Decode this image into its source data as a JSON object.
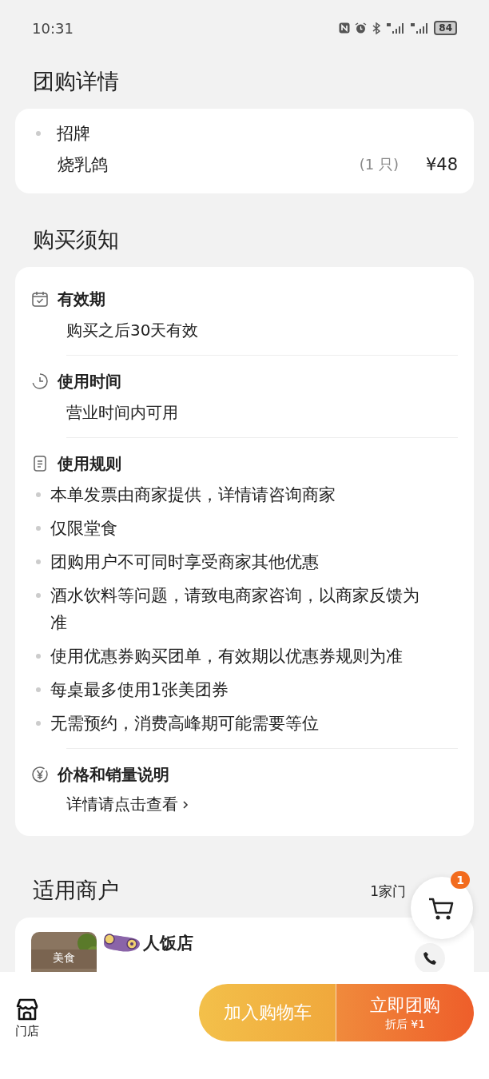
{
  "status_bar": {
    "time": "10:31",
    "battery": "84"
  },
  "deal_details": {
    "title": "团购详情",
    "items": [
      {
        "group": "招牌",
        "name": "烧乳鸽",
        "quantity": "(1 只)",
        "price": "¥48"
      }
    ]
  },
  "purchase_notes": {
    "title": "购买须知",
    "sections": [
      {
        "kind": "validity",
        "title": "有效期",
        "lines": [
          "购买之后30天有效"
        ]
      },
      {
        "kind": "hours",
        "title": "使用时间",
        "lines": [
          "营业时间内可用"
        ]
      },
      {
        "kind": "rules",
        "title": "使用规则",
        "bullets": [
          "本单发票由商家提供，详情请咨询商家",
          "仅限堂食",
          "团购用户不可同时享受商家其他优惠",
          "酒水饮料等问题，请致电商家咨询，以商家反馈为准",
          "使用优惠券购买团单，有效期以优惠券规则为准",
          "每桌最多使用1张美团券",
          "无需预约，消费高峰期可能需要等位"
        ]
      },
      {
        "kind": "price",
        "title": "价格和销量说明",
        "link": "详情请点击查看"
      }
    ]
  },
  "merchants": {
    "title": "适用商户",
    "count": "1家门",
    "cart_badge": "1",
    "items": [
      {
        "category": "美食",
        "name": "人饭店"
      }
    ]
  },
  "bottom_bar": {
    "store_label": "门店",
    "add_to_cart": "加入购物车",
    "buy_now": "立即团购",
    "buy_now_sub": "折后 ¥1"
  }
}
